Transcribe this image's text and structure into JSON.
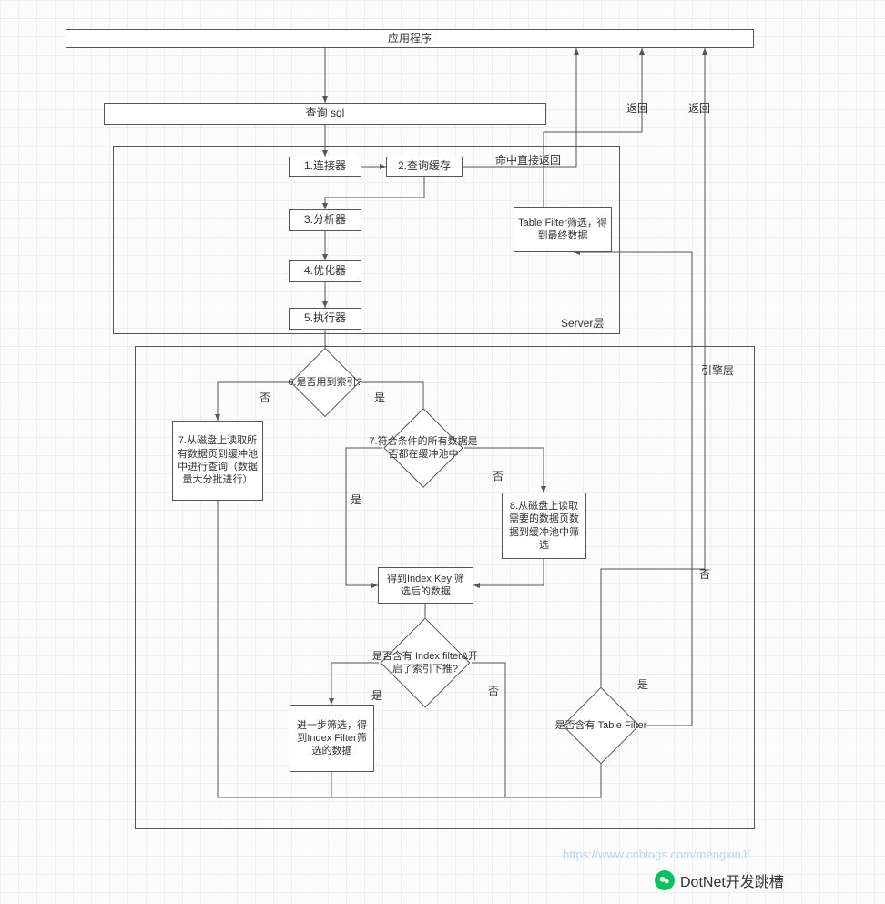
{
  "boxes": {
    "app": "应用程序",
    "sql": "查询 sql",
    "connector": "1.连接器",
    "query_cache": "2.查询缓存",
    "analyzer": "3.分析器",
    "optimizer": "4.优化器",
    "executor": "5.执行器",
    "table_filter_final": "Table Filter筛选，得到最终数据",
    "disk_read_all": "7.从磁盘上读取所有数据页到缓冲池中进行查询（数据量大分批进行）",
    "disk_read_needed": "8.从磁盘上读取需要的数据页数据到缓冲池中筛选",
    "index_key_result": "得到Index Key 筛选后的数据",
    "index_filter_result": "进一步筛选，得到Index Filter筛选的数据"
  },
  "diamonds": {
    "use_index": "6.是否用到索引?",
    "all_in_buffer": "7.符合条件的所有数据是否都在缓冲池中",
    "has_index_filter": "是否含有 Index filter&开启了索引下推?",
    "has_table_filter": "是否含有 Table Filter"
  },
  "labels": {
    "return1": "返回",
    "return2": "返回",
    "cache_hit": "命中直接返回",
    "server_layer": "Server层",
    "engine_layer": "引擎层",
    "yes": "是",
    "no": "否"
  },
  "watermark": "https://www.cnblogs.com/mengxinJ/",
  "brand": "DotNet开发跳槽"
}
